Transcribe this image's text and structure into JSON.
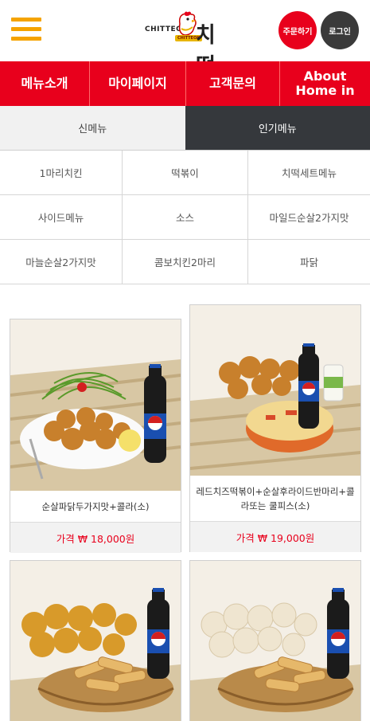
{
  "header": {
    "logo_en": "CHITTEOK",
    "logo_ko": "치떡",
    "logo_badge": "CHITTEOK",
    "order_label": "주문하기",
    "login_label": "로그인"
  },
  "topnav": {
    "items": [
      {
        "label": "메뉴소개"
      },
      {
        "label": "마이페이지"
      },
      {
        "label": "고객문의"
      },
      {
        "label": "About Home in"
      }
    ]
  },
  "tabs": [
    {
      "label": "신메뉴",
      "active": false
    },
    {
      "label": "인기메뉴",
      "active": true
    }
  ],
  "categories": [
    [
      "1마리치킨",
      "떡볶이",
      "치떡세트메뉴"
    ],
    [
      "사이드메뉴",
      "소스",
      "마일드순살2가지맛"
    ],
    [
      "마늘순살2가지맛",
      "콤보치킨2마리",
      "파닭"
    ]
  ],
  "products": [
    {
      "name": "순살파닭두가지맛+콜라(소)",
      "price": "가격 ₩ 18,000원"
    },
    {
      "name": "레드치즈떡볶이+순살후라이드반마리+콜라또는 쿨피스(소)",
      "price": "가격 ₩ 19,000원"
    },
    {
      "name": "",
      "price": ""
    },
    {
      "name": "",
      "price": ""
    }
  ],
  "colors": {
    "brand_red": "#e8001c",
    "hamburger_orange": "#f5a300",
    "tab_active": "#35383c"
  },
  "icons": {
    "menu": "hamburger-menu-icon",
    "logo": "chicken-logo-icon",
    "cola": "cola-bottle-icon"
  }
}
